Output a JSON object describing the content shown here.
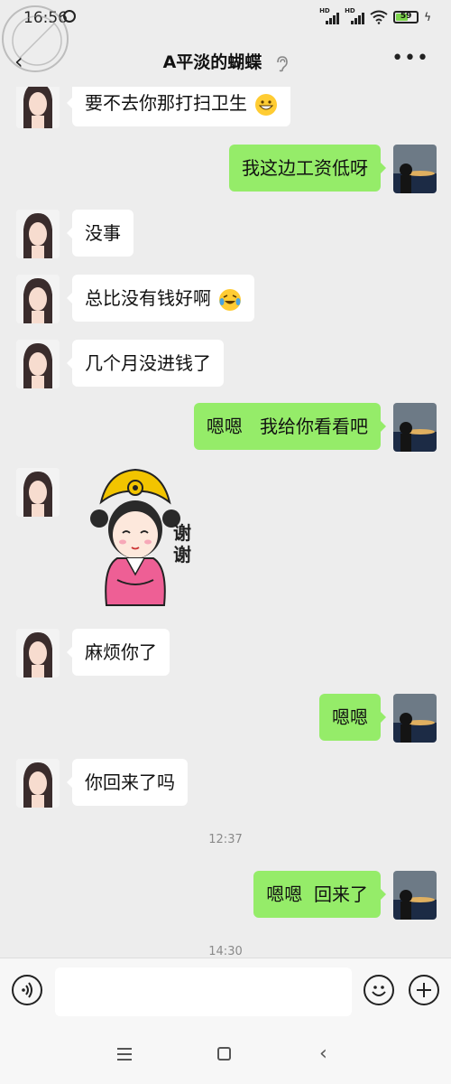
{
  "status_bar": {
    "time": "16:56",
    "battery": "59",
    "battery_level": 0.59,
    "signal_1": "HD",
    "signal_2": "HD"
  },
  "watermark": {
    "text": "海角社区 haijiao.com"
  },
  "header": {
    "title": "A平淡的蝴蝶"
  },
  "icons": {
    "back": "back-arrow-icon",
    "ear": "ear-icon",
    "more": "more-icon",
    "voice": "voice-icon",
    "emoji": "emoji-icon",
    "plus": "plus-icon",
    "grin": "grinning-face-emoji",
    "cry": "crying-laughing-emoji"
  },
  "messages": [
    {
      "side": "left",
      "text": "要不去你那打扫卫生",
      "emoji": "grin"
    },
    {
      "side": "right",
      "text": "我这边工资低呀"
    },
    {
      "side": "left",
      "text": "没事"
    },
    {
      "side": "left",
      "text": "总比没有钱好啊",
      "emoji": "cry"
    },
    {
      "side": "left",
      "text": "几个月没进钱了"
    },
    {
      "side": "right",
      "text": "嗯嗯   我给你看看吧"
    },
    {
      "side": "left",
      "sticker": "thank-you-princess-sticker",
      "sticker_text": "谢谢"
    },
    {
      "side": "left",
      "text": "麻烦你了"
    },
    {
      "side": "right",
      "text": "嗯嗯"
    },
    {
      "side": "left",
      "text": "你回来了吗"
    },
    {
      "side": "right",
      "text": "嗯嗯  回来了"
    }
  ],
  "timestamps": [
    "12:37",
    "14:30"
  ],
  "colors": {
    "background": "#ededed",
    "my_bubble": "#95ec69",
    "their_bubble": "#ffffff",
    "battery": "#7ad34a"
  }
}
